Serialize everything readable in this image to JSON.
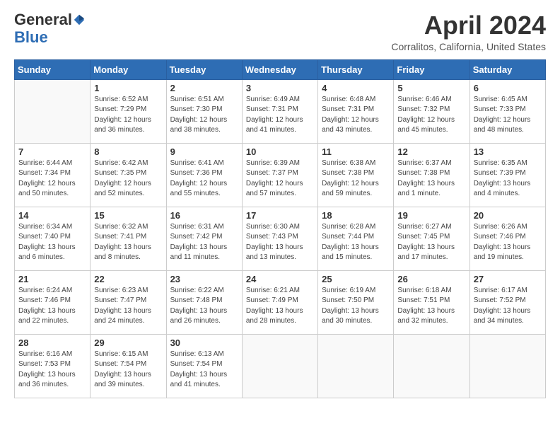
{
  "header": {
    "logo_general": "General",
    "logo_blue": "Blue",
    "month_title": "April 2024",
    "location": "Corralitos, California, United States"
  },
  "weekdays": [
    "Sunday",
    "Monday",
    "Tuesday",
    "Wednesday",
    "Thursday",
    "Friday",
    "Saturday"
  ],
  "weeks": [
    [
      {
        "day": "",
        "empty": true
      },
      {
        "day": "1",
        "sunrise": "Sunrise: 6:52 AM",
        "sunset": "Sunset: 7:29 PM",
        "daylight": "Daylight: 12 hours and 36 minutes."
      },
      {
        "day": "2",
        "sunrise": "Sunrise: 6:51 AM",
        "sunset": "Sunset: 7:30 PM",
        "daylight": "Daylight: 12 hours and 38 minutes."
      },
      {
        "day": "3",
        "sunrise": "Sunrise: 6:49 AM",
        "sunset": "Sunset: 7:31 PM",
        "daylight": "Daylight: 12 hours and 41 minutes."
      },
      {
        "day": "4",
        "sunrise": "Sunrise: 6:48 AM",
        "sunset": "Sunset: 7:31 PM",
        "daylight": "Daylight: 12 hours and 43 minutes."
      },
      {
        "day": "5",
        "sunrise": "Sunrise: 6:46 AM",
        "sunset": "Sunset: 7:32 PM",
        "daylight": "Daylight: 12 hours and 45 minutes."
      },
      {
        "day": "6",
        "sunrise": "Sunrise: 6:45 AM",
        "sunset": "Sunset: 7:33 PM",
        "daylight": "Daylight: 12 hours and 48 minutes."
      }
    ],
    [
      {
        "day": "7",
        "sunrise": "Sunrise: 6:44 AM",
        "sunset": "Sunset: 7:34 PM",
        "daylight": "Daylight: 12 hours and 50 minutes."
      },
      {
        "day": "8",
        "sunrise": "Sunrise: 6:42 AM",
        "sunset": "Sunset: 7:35 PM",
        "daylight": "Daylight: 12 hours and 52 minutes."
      },
      {
        "day": "9",
        "sunrise": "Sunrise: 6:41 AM",
        "sunset": "Sunset: 7:36 PM",
        "daylight": "Daylight: 12 hours and 55 minutes."
      },
      {
        "day": "10",
        "sunrise": "Sunrise: 6:39 AM",
        "sunset": "Sunset: 7:37 PM",
        "daylight": "Daylight: 12 hours and 57 minutes."
      },
      {
        "day": "11",
        "sunrise": "Sunrise: 6:38 AM",
        "sunset": "Sunset: 7:38 PM",
        "daylight": "Daylight: 12 hours and 59 minutes."
      },
      {
        "day": "12",
        "sunrise": "Sunrise: 6:37 AM",
        "sunset": "Sunset: 7:38 PM",
        "daylight": "Daylight: 13 hours and 1 minute."
      },
      {
        "day": "13",
        "sunrise": "Sunrise: 6:35 AM",
        "sunset": "Sunset: 7:39 PM",
        "daylight": "Daylight: 13 hours and 4 minutes."
      }
    ],
    [
      {
        "day": "14",
        "sunrise": "Sunrise: 6:34 AM",
        "sunset": "Sunset: 7:40 PM",
        "daylight": "Daylight: 13 hours and 6 minutes."
      },
      {
        "day": "15",
        "sunrise": "Sunrise: 6:32 AM",
        "sunset": "Sunset: 7:41 PM",
        "daylight": "Daylight: 13 hours and 8 minutes."
      },
      {
        "day": "16",
        "sunrise": "Sunrise: 6:31 AM",
        "sunset": "Sunset: 7:42 PM",
        "daylight": "Daylight: 13 hours and 11 minutes."
      },
      {
        "day": "17",
        "sunrise": "Sunrise: 6:30 AM",
        "sunset": "Sunset: 7:43 PM",
        "daylight": "Daylight: 13 hours and 13 minutes."
      },
      {
        "day": "18",
        "sunrise": "Sunrise: 6:28 AM",
        "sunset": "Sunset: 7:44 PM",
        "daylight": "Daylight: 13 hours and 15 minutes."
      },
      {
        "day": "19",
        "sunrise": "Sunrise: 6:27 AM",
        "sunset": "Sunset: 7:45 PM",
        "daylight": "Daylight: 13 hours and 17 minutes."
      },
      {
        "day": "20",
        "sunrise": "Sunrise: 6:26 AM",
        "sunset": "Sunset: 7:46 PM",
        "daylight": "Daylight: 13 hours and 19 minutes."
      }
    ],
    [
      {
        "day": "21",
        "sunrise": "Sunrise: 6:24 AM",
        "sunset": "Sunset: 7:46 PM",
        "daylight": "Daylight: 13 hours and 22 minutes."
      },
      {
        "day": "22",
        "sunrise": "Sunrise: 6:23 AM",
        "sunset": "Sunset: 7:47 PM",
        "daylight": "Daylight: 13 hours and 24 minutes."
      },
      {
        "day": "23",
        "sunrise": "Sunrise: 6:22 AM",
        "sunset": "Sunset: 7:48 PM",
        "daylight": "Daylight: 13 hours and 26 minutes."
      },
      {
        "day": "24",
        "sunrise": "Sunrise: 6:21 AM",
        "sunset": "Sunset: 7:49 PM",
        "daylight": "Daylight: 13 hours and 28 minutes."
      },
      {
        "day": "25",
        "sunrise": "Sunrise: 6:19 AM",
        "sunset": "Sunset: 7:50 PM",
        "daylight": "Daylight: 13 hours and 30 minutes."
      },
      {
        "day": "26",
        "sunrise": "Sunrise: 6:18 AM",
        "sunset": "Sunset: 7:51 PM",
        "daylight": "Daylight: 13 hours and 32 minutes."
      },
      {
        "day": "27",
        "sunrise": "Sunrise: 6:17 AM",
        "sunset": "Sunset: 7:52 PM",
        "daylight": "Daylight: 13 hours and 34 minutes."
      }
    ],
    [
      {
        "day": "28",
        "sunrise": "Sunrise: 6:16 AM",
        "sunset": "Sunset: 7:53 PM",
        "daylight": "Daylight: 13 hours and 36 minutes."
      },
      {
        "day": "29",
        "sunrise": "Sunrise: 6:15 AM",
        "sunset": "Sunset: 7:54 PM",
        "daylight": "Daylight: 13 hours and 39 minutes."
      },
      {
        "day": "30",
        "sunrise": "Sunrise: 6:13 AM",
        "sunset": "Sunset: 7:54 PM",
        "daylight": "Daylight: 13 hours and 41 minutes."
      },
      {
        "day": "",
        "empty": true
      },
      {
        "day": "",
        "empty": true
      },
      {
        "day": "",
        "empty": true
      },
      {
        "day": "",
        "empty": true
      }
    ]
  ]
}
